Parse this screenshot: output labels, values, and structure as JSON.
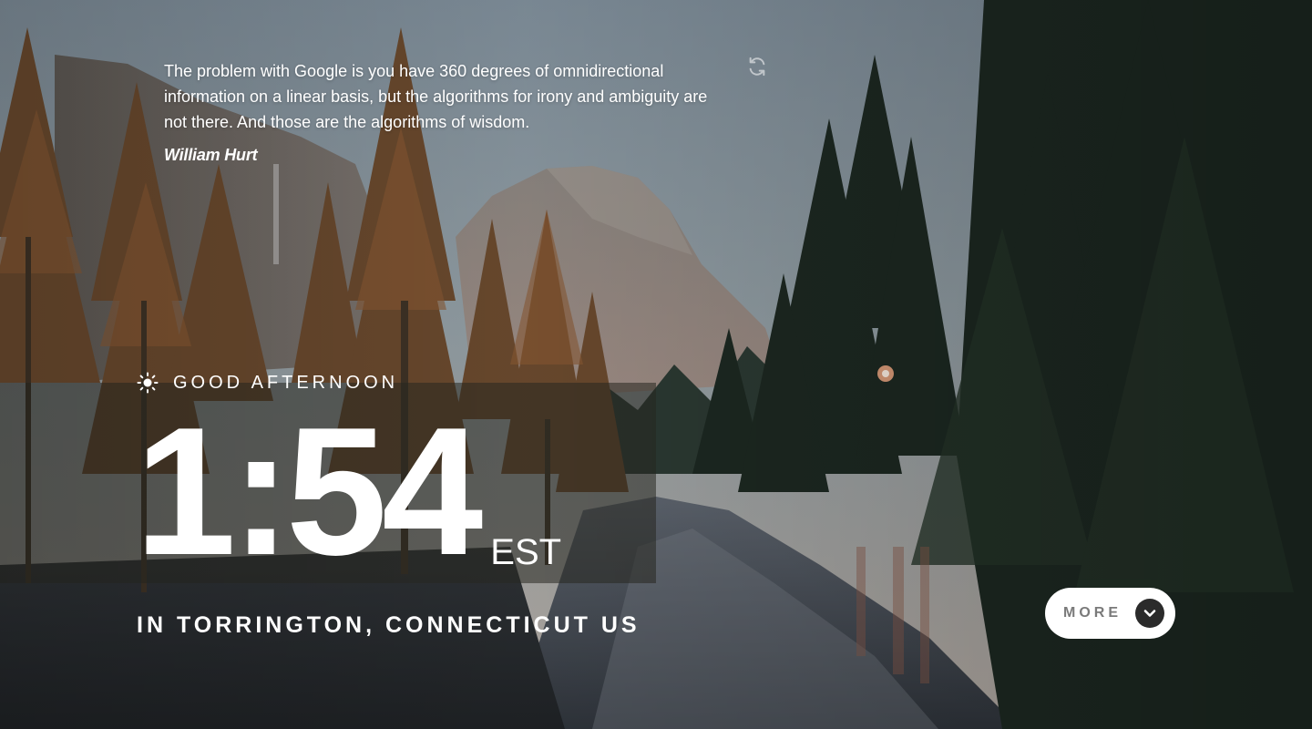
{
  "quote": {
    "text": "The problem with Google is you have 360 degrees of omnidirectional information on a linear basis, but the algorithms for irony and ambiguity are not there. And those are the algorithms of wisdom.",
    "author": "William Hurt",
    "refresh_icon": "refresh-icon"
  },
  "greeting": {
    "icon": "sun-icon",
    "text": "GOOD AFTERNOON"
  },
  "clock": {
    "time": "1:54",
    "timezone": "EST"
  },
  "location": {
    "text": "IN TORRINGTON, CONNECTICUT US"
  },
  "more": {
    "label": "MORE",
    "icon": "chevron-down-icon"
  },
  "colors": {
    "text": "#ffffff",
    "button_bg": "#ffffff",
    "button_text": "#7a7a7a",
    "chevron_bg": "#2b2b2b"
  }
}
